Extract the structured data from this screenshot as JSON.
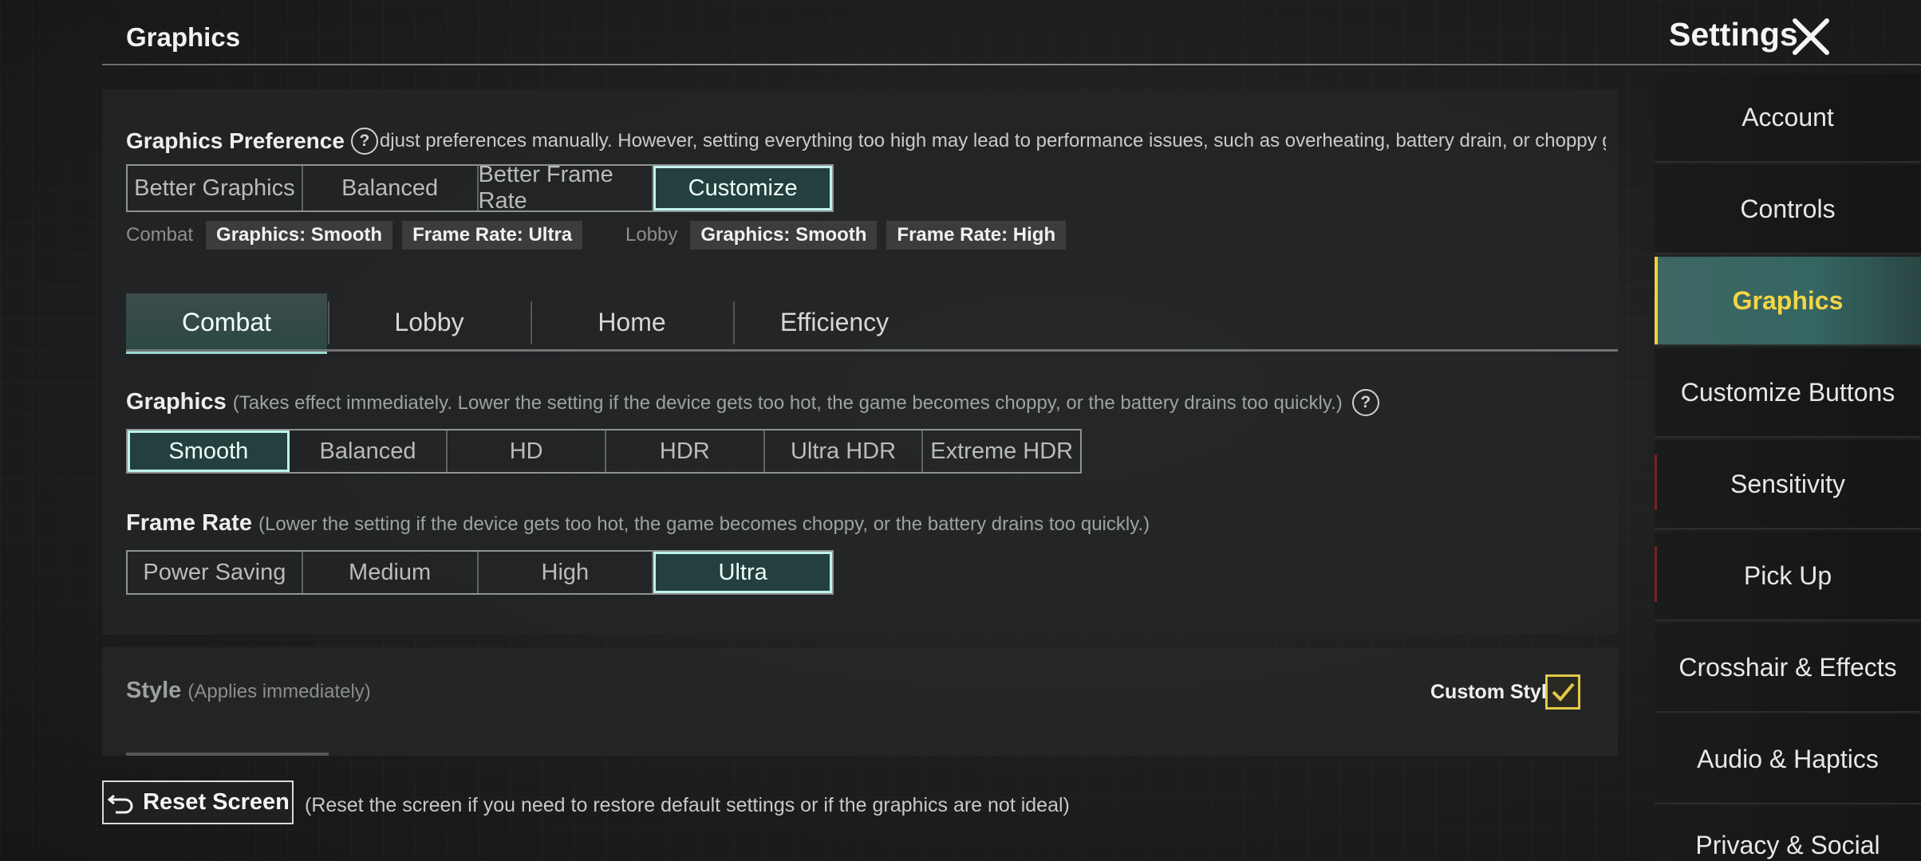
{
  "header": {
    "section_title": "Graphics",
    "settings_title": "Settings"
  },
  "preference": {
    "label": "Graphics Preference",
    "help_glyph": "?",
    "description": "djust preferences manually. However, setting everything too high may lead to performance issues, such as overheating, battery drain, or choppy gamepl",
    "options": [
      "Better Graphics",
      "Balanced",
      "Better Frame Rate",
      "Customize"
    ],
    "selected": "Customize"
  },
  "summary": {
    "combat_label": "Combat",
    "combat_graphics": "Graphics: Smooth",
    "combat_framerate": "Frame Rate: Ultra",
    "lobby_label": "Lobby",
    "lobby_graphics": "Graphics: Smooth",
    "lobby_framerate": "Frame Rate: High"
  },
  "tabs": {
    "items": [
      "Combat",
      "Lobby",
      "Home",
      "Efficiency"
    ],
    "active": "Combat"
  },
  "graphics": {
    "label": "Graphics",
    "hint": "(Takes effect immediately. Lower the setting if the device gets too hot, the game becomes choppy, or the battery drains too quickly.)",
    "options": [
      "Smooth",
      "Balanced",
      "HD",
      "HDR",
      "Ultra HDR",
      "Extreme HDR"
    ],
    "selected": "Smooth"
  },
  "frame_rate": {
    "label": "Frame Rate",
    "hint": "(Lower the setting if the device gets too hot, the game becomes choppy, or the battery drains too quickly.)",
    "options": [
      "Power Saving",
      "Medium",
      "High",
      "Ultra"
    ],
    "selected": "Ultra"
  },
  "style": {
    "label": "Style",
    "hint": "(Applies immediately)",
    "custom_style_label": "Custom Style",
    "custom_style_checked": true
  },
  "reset": {
    "label": "Reset Screen",
    "hint": "(Reset the screen if you need to restore default settings or if the graphics are not ideal)"
  },
  "sidebar": {
    "items": [
      "Account",
      "Controls",
      "Graphics",
      "Customize Buttons",
      "Sensitivity",
      "Pick Up",
      "Crosshair & Effects",
      "Audio & Haptics",
      "Privacy & Social"
    ],
    "active": "Graphics"
  },
  "colors": {
    "accent_teal": "#bff2ea",
    "active_sidebar_text": "#f3d544",
    "checkbox_yellow": "#e3c84a"
  }
}
